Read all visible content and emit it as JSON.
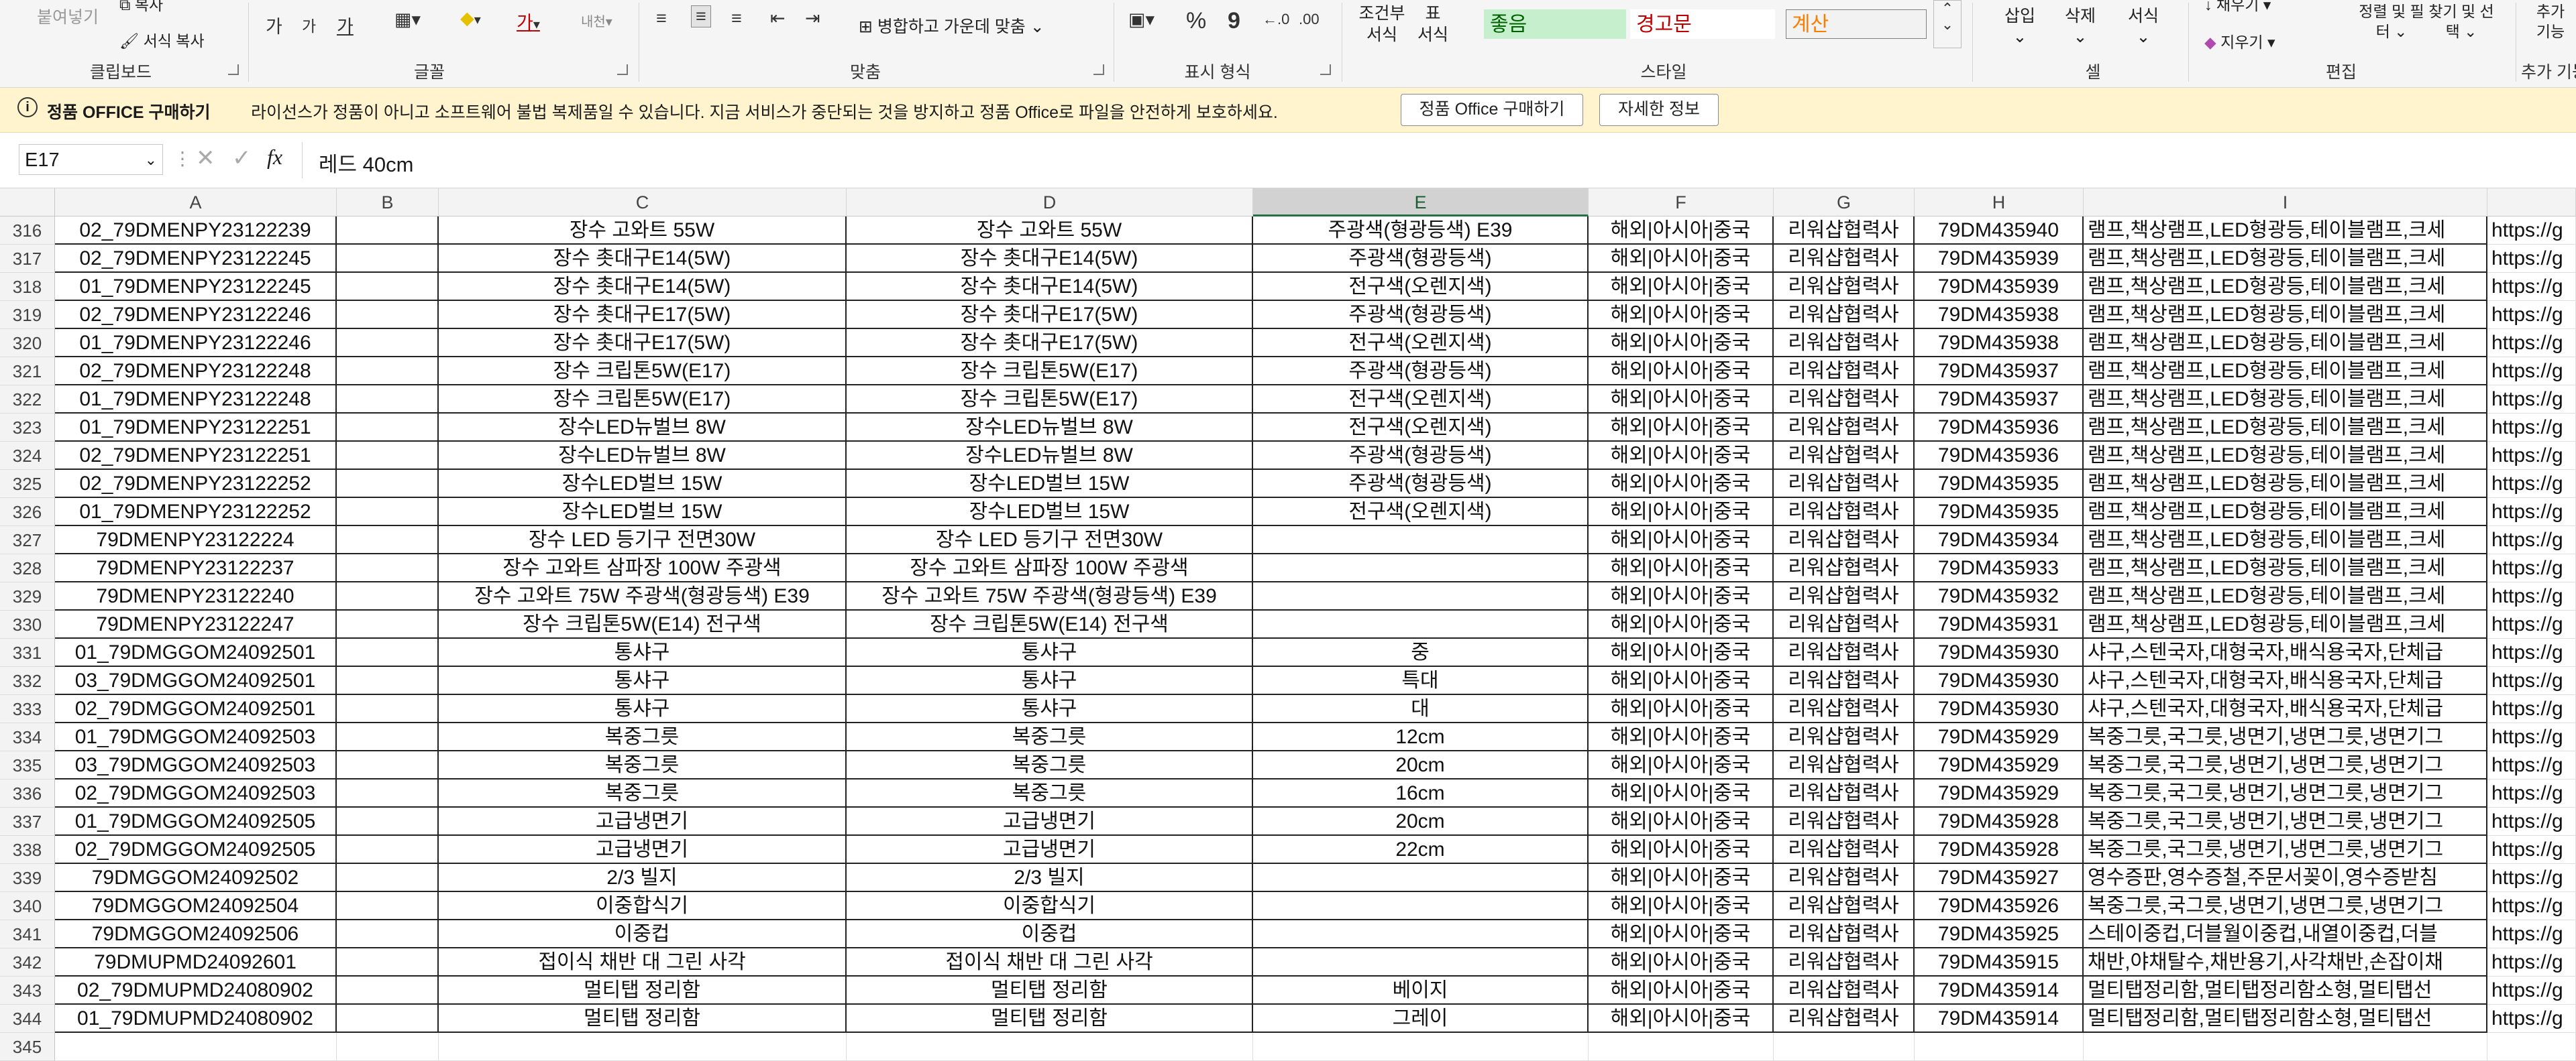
{
  "ribbon": {
    "clipboard": {
      "paste": "붙여넣기",
      "copy": "복사",
      "format_painter": "서식 복사",
      "group": "클립보드"
    },
    "font": {
      "group": "글꼴",
      "grow": "가",
      "shrink": "가",
      "underline": "가"
    },
    "alignment": {
      "merge_center": "병합하고 가운데 맞춤",
      "group": "맞춤"
    },
    "number": {
      "percent": "%",
      "comma": "9",
      "group": "표시 형식"
    },
    "styles": {
      "conditional": "조건부 서식",
      "table": "표 서식",
      "good": "좋음",
      "bad": "경고문",
      "calc": "계산",
      "group": "스타일",
      "colors": {
        "good_bg": "#c6efce",
        "good_fg": "#006100",
        "bad_fg": "#c00000",
        "calc_bg": "#f2f2f2",
        "calc_fg": "#fa7d00"
      }
    },
    "cells": {
      "insert": "삽입",
      "delete": "삭제",
      "format": "서식",
      "group": "셀"
    },
    "editing": {
      "fill": "채우기",
      "clear": "지우기",
      "sort": "정렬 및 필터",
      "find": "찾기 및 선택",
      "group": "편집"
    },
    "addins": {
      "label": "추가 기능",
      "group": "추가 기능"
    }
  },
  "infobar": {
    "title": "정품 OFFICE 구매하기",
    "message": "라이선스가 정품이 아니고 소프트웨어 불법 복제품일 수 있습니다. 지금 서비스가 중단되는 것을 방지하고 정품 Office로 파일을 안전하게 보호하세요.",
    "buy_button": "정품 Office 구매하기",
    "details_button": "자세한 정보"
  },
  "formula_bar": {
    "name_box": "E17",
    "fx": "fx",
    "formula": "레드 40cm"
  },
  "columns": [
    "A",
    "B",
    "C",
    "D",
    "E",
    "F",
    "G",
    "H",
    "I"
  ],
  "selected_column": "E",
  "rows": [
    {
      "n": "316",
      "a": "02_79DMENPY23122239",
      "c": "장수 고와트 55W",
      "d": "장수 고와트 55W",
      "e": "주광색(형광등색) E39",
      "f": "해외|아시아|중국",
      "g": "리워샵협력사",
      "h": "79DM435940",
      "i": "램프,책상램프,LED형광등,테이블램프,크세",
      "j": "https://g"
    },
    {
      "n": "317",
      "a": "02_79DMENPY23122245",
      "c": "장수 촛대구E14(5W)",
      "d": "장수 촛대구E14(5W)",
      "e": "주광색(형광등색)",
      "f": "해외|아시아|중국",
      "g": "리워샵협력사",
      "h": "79DM435939",
      "i": "램프,책상램프,LED형광등,테이블램프,크세",
      "j": "https://g"
    },
    {
      "n": "318",
      "a": "01_79DMENPY23122245",
      "c": "장수 촛대구E14(5W)",
      "d": "장수 촛대구E14(5W)",
      "e": "전구색(오렌지색)",
      "f": "해외|아시아|중국",
      "g": "리워샵협력사",
      "h": "79DM435939",
      "i": "램프,책상램프,LED형광등,테이블램프,크세",
      "j": "https://g"
    },
    {
      "n": "319",
      "a": "02_79DMENPY23122246",
      "c": "장수 촛대구E17(5W)",
      "d": "장수 촛대구E17(5W)",
      "e": "주광색(형광등색)",
      "f": "해외|아시아|중국",
      "g": "리워샵협력사",
      "h": "79DM435938",
      "i": "램프,책상램프,LED형광등,테이블램프,크세",
      "j": "https://g"
    },
    {
      "n": "320",
      "a": "01_79DMENPY23122246",
      "c": "장수 촛대구E17(5W)",
      "d": "장수 촛대구E17(5W)",
      "e": "전구색(오렌지색)",
      "f": "해외|아시아|중국",
      "g": "리워샵협력사",
      "h": "79DM435938",
      "i": "램프,책상램프,LED형광등,테이블램프,크세",
      "j": "https://g"
    },
    {
      "n": "321",
      "a": "02_79DMENPY23122248",
      "c": "장수 크립톤5W(E17)",
      "d": "장수 크립톤5W(E17)",
      "e": "주광색(형광등색)",
      "f": "해외|아시아|중국",
      "g": "리워샵협력사",
      "h": "79DM435937",
      "i": "램프,책상램프,LED형광등,테이블램프,크세",
      "j": "https://g"
    },
    {
      "n": "322",
      "a": "01_79DMENPY23122248",
      "c": "장수 크립톤5W(E17)",
      "d": "장수 크립톤5W(E17)",
      "e": "전구색(오렌지색)",
      "f": "해외|아시아|중국",
      "g": "리워샵협력사",
      "h": "79DM435937",
      "i": "램프,책상램프,LED형광등,테이블램프,크세",
      "j": "https://g"
    },
    {
      "n": "323",
      "a": "01_79DMENPY23122251",
      "c": "장수LED뉴벌브 8W",
      "d": "장수LED뉴벌브 8W",
      "e": "전구색(오렌지색)",
      "f": "해외|아시아|중국",
      "g": "리워샵협력사",
      "h": "79DM435936",
      "i": "램프,책상램프,LED형광등,테이블램프,크세",
      "j": "https://g"
    },
    {
      "n": "324",
      "a": "02_79DMENPY23122251",
      "c": "장수LED뉴벌브 8W",
      "d": "장수LED뉴벌브 8W",
      "e": "주광색(형광등색)",
      "f": "해외|아시아|중국",
      "g": "리워샵협력사",
      "h": "79DM435936",
      "i": "램프,책상램프,LED형광등,테이블램프,크세",
      "j": "https://g"
    },
    {
      "n": "325",
      "a": "02_79DMENPY23122252",
      "c": "장수LED벌브 15W",
      "d": "장수LED벌브 15W",
      "e": "주광색(형광등색)",
      "f": "해외|아시아|중국",
      "g": "리워샵협력사",
      "h": "79DM435935",
      "i": "램프,책상램프,LED형광등,테이블램프,크세",
      "j": "https://g"
    },
    {
      "n": "326",
      "a": "01_79DMENPY23122252",
      "c": "장수LED벌브 15W",
      "d": "장수LED벌브 15W",
      "e": "전구색(오렌지색)",
      "f": "해외|아시아|중국",
      "g": "리워샵협력사",
      "h": "79DM435935",
      "i": "램프,책상램프,LED형광등,테이블램프,크세",
      "j": "https://g"
    },
    {
      "n": "327",
      "a": "79DMENPY23122224",
      "c": "장수 LED 등기구 전면30W",
      "d": "장수 LED 등기구 전면30W",
      "e": "",
      "f": "해외|아시아|중국",
      "g": "리워샵협력사",
      "h": "79DM435934",
      "i": "램프,책상램프,LED형광등,테이블램프,크세",
      "j": "https://g"
    },
    {
      "n": "328",
      "a": "79DMENPY23122237",
      "c": "장수 고와트 삼파장 100W 주광색",
      "d": "장수 고와트 삼파장 100W 주광색",
      "e": "",
      "f": "해외|아시아|중국",
      "g": "리워샵협력사",
      "h": "79DM435933",
      "i": "램프,책상램프,LED형광등,테이블램프,크세",
      "j": "https://g"
    },
    {
      "n": "329",
      "a": "79DMENPY23122240",
      "c": "장수 고와트 75W 주광색(형광등색) E39",
      "d": "장수 고와트 75W 주광색(형광등색) E39",
      "e": "",
      "f": "해외|아시아|중국",
      "g": "리워샵협력사",
      "h": "79DM435932",
      "i": "램프,책상램프,LED형광등,테이블램프,크세",
      "j": "https://g"
    },
    {
      "n": "330",
      "a": "79DMENPY23122247",
      "c": "장수 크립톤5W(E14) 전구색",
      "d": "장수 크립톤5W(E14) 전구색",
      "e": "",
      "f": "해외|아시아|중국",
      "g": "리워샵협력사",
      "h": "79DM435931",
      "i": "램프,책상램프,LED형광등,테이블램프,크세",
      "j": "https://g"
    },
    {
      "n": "331",
      "a": "01_79DMGGOM24092501",
      "c": "통샤구",
      "d": "통샤구",
      "e": "중",
      "f": "해외|아시아|중국",
      "g": "리워샵협력사",
      "h": "79DM435930",
      "i": "샤구,스텐국자,대형국자,배식용국자,단체급",
      "j": "https://g"
    },
    {
      "n": "332",
      "a": "03_79DMGGOM24092501",
      "c": "통샤구",
      "d": "통샤구",
      "e": "특대",
      "f": "해외|아시아|중국",
      "g": "리워샵협력사",
      "h": "79DM435930",
      "i": "샤구,스텐국자,대형국자,배식용국자,단체급",
      "j": "https://g"
    },
    {
      "n": "333",
      "a": "02_79DMGGOM24092501",
      "c": "통샤구",
      "d": "통샤구",
      "e": "대",
      "f": "해외|아시아|중국",
      "g": "리워샵협력사",
      "h": "79DM435930",
      "i": "샤구,스텐국자,대형국자,배식용국자,단체급",
      "j": "https://g"
    },
    {
      "n": "334",
      "a": "01_79DMGGOM24092503",
      "c": "복중그릇",
      "d": "복중그릇",
      "e": "12cm",
      "f": "해외|아시아|중국",
      "g": "리워샵협력사",
      "h": "79DM435929",
      "i": "복중그릇,국그릇,냉면기,냉면그릇,냉면기그",
      "j": "https://g"
    },
    {
      "n": "335",
      "a": "03_79DMGGOM24092503",
      "c": "복중그릇",
      "d": "복중그릇",
      "e": "20cm",
      "f": "해외|아시아|중국",
      "g": "리워샵협력사",
      "h": "79DM435929",
      "i": "복중그릇,국그릇,냉면기,냉면그릇,냉면기그",
      "j": "https://g"
    },
    {
      "n": "336",
      "a": "02_79DMGGOM24092503",
      "c": "복중그릇",
      "d": "복중그릇",
      "e": "16cm",
      "f": "해외|아시아|중국",
      "g": "리워샵협력사",
      "h": "79DM435929",
      "i": "복중그릇,국그릇,냉면기,냉면그릇,냉면기그",
      "j": "https://g"
    },
    {
      "n": "337",
      "a": "01_79DMGGOM24092505",
      "c": "고급냉면기",
      "d": "고급냉면기",
      "e": "20cm",
      "f": "해외|아시아|중국",
      "g": "리워샵협력사",
      "h": "79DM435928",
      "i": "복중그릇,국그릇,냉면기,냉면그릇,냉면기그",
      "j": "https://g"
    },
    {
      "n": "338",
      "a": "02_79DMGGOM24092505",
      "c": "고급냉면기",
      "d": "고급냉면기",
      "e": "22cm",
      "f": "해외|아시아|중국",
      "g": "리워샵협력사",
      "h": "79DM435928",
      "i": "복중그릇,국그릇,냉면기,냉면그릇,냉면기그",
      "j": "https://g"
    },
    {
      "n": "339",
      "a": "79DMGGOM24092502",
      "c": "2/3 빌지",
      "d": "2/3 빌지",
      "e": "",
      "f": "해외|아시아|중국",
      "g": "리워샵협력사",
      "h": "79DM435927",
      "i": "영수증판,영수증철,주문서꽂이,영수증받침",
      "j": "https://g"
    },
    {
      "n": "340",
      "a": "79DMGGOM24092504",
      "c": "이중합식기",
      "d": "이중합식기",
      "e": "",
      "f": "해외|아시아|중국",
      "g": "리워샵협력사",
      "h": "79DM435926",
      "i": "복중그릇,국그릇,냉면기,냉면그릇,냉면기그",
      "j": "https://g"
    },
    {
      "n": "341",
      "a": "79DMGGOM24092506",
      "c": "이중컵",
      "d": "이중컵",
      "e": "",
      "f": "해외|아시아|중국",
      "g": "리워샵협력사",
      "h": "79DM435925",
      "i": "스테이중컵,더블월이중컵,내열이중컵,더블",
      "j": "https://g"
    },
    {
      "n": "342",
      "a": "79DMUPMD24092601",
      "c": "접이식 채반 대 그린 사각",
      "d": "접이식 채반 대 그린 사각",
      "e": "",
      "f": "해외|아시아|중국",
      "g": "리워샵협력사",
      "h": "79DM435915",
      "i": "채반,야채탈수,채반용기,사각채반,손잡이채",
      "j": "https://g"
    },
    {
      "n": "343",
      "a": "02_79DMUPMD24080902",
      "c": "멀티탭 정리함",
      "d": "멀티탭 정리함",
      "e": "베이지",
      "f": "해외|아시아|중국",
      "g": "리워샵협력사",
      "h": "79DM435914",
      "i": "멀티탭정리함,멀티탭정리함소형,멀티탭선",
      "j": "https://g"
    },
    {
      "n": "344",
      "a": "01_79DMUPMD24080902",
      "c": "멀티탭 정리함",
      "d": "멀티탭 정리함",
      "e": "그레이",
      "f": "해외|아시아|중국",
      "g": "리워샵협력사",
      "h": "79DM435914",
      "i": "멀티탭정리함,멀티탭정리함소형,멀티탭선",
      "j": "https://g"
    },
    {
      "n": "345",
      "a": "",
      "c": "",
      "d": "",
      "e": "",
      "f": "",
      "g": "",
      "h": "",
      "i": "",
      "j": ""
    }
  ]
}
